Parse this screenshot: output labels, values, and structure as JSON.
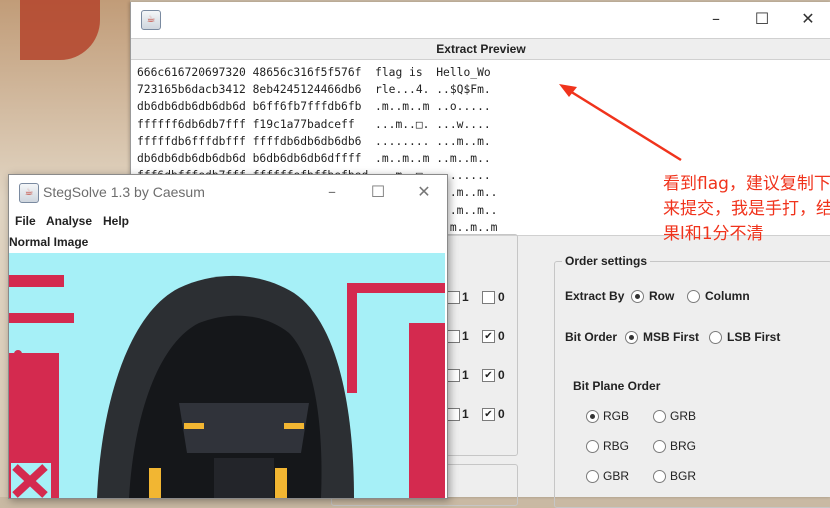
{
  "colors": {
    "annotation_red": "#f0331c",
    "image_cyan": "#a6f0f7",
    "image_magenta": "#d42a4f"
  },
  "extract_window": {
    "icon": "java-cup-icon",
    "panel_title": "Extract Preview",
    "text_lines": [
      "666c616720697320 48656c316f5f576f  flag is  Hello_Wo",
      "723165b6dacb3412 8eb4245124466db6  rle...4. ..$Q$Fm.",
      "db6db6db6db6db6d b6ff6fb7fffdb6fb  .m..m..m ..o.....",
      "ffffff6db6db7fff f19c1a77badceff   ...m..□. ...w....",
      "fffffdb6fffdbfff ffffdb6db6db6db6  ........ ...m..m.",
      "db6db6db6db6db6d b6db6db6db6dffff  .m..m..m ..m..m..",
      "fff6dbfffedb7fff ffffffefbffbefbed ...m..□. ........",
      "                                    .m..m..m ..m..m..",
      "                                    .m..m..m ..m..m..",
      "                                    .m..m..m .m..m..m"
    ],
    "order_settings": {
      "title": "Order settings",
      "extract_by_label": "Extract By",
      "extract_by_options": [
        "Row",
        "Column"
      ],
      "extract_by_selected": "Row",
      "bit_order_label": "Bit Order",
      "bit_order_options": [
        "MSB First",
        "LSB First"
      ],
      "bit_order_selected": "MSB First",
      "bit_plane_order_label": "Bit Plane Order",
      "bit_plane_options": [
        "RGB",
        "GRB",
        "RBG",
        "BRG",
        "GBR",
        "BGR"
      ],
      "bit_plane_selected": "RGB"
    },
    "bit_planes": [
      {
        "one": "1",
        "zero": "0",
        "zero_checked": false
      },
      {
        "one": "1",
        "zero": "0",
        "zero_checked": true
      },
      {
        "one": "1",
        "zero": "0",
        "zero_checked": true
      },
      {
        "one": "1",
        "zero": "0",
        "zero_checked": true
      }
    ],
    "annotation_text": "看到flag，建议复制下来提交，我是手打，结果l和1分不清"
  },
  "stegsolve_window": {
    "icon": "java-cup-icon",
    "title": "StegSolve 1.3 by Caesum",
    "menu": [
      "File",
      "Analyse",
      "Help"
    ],
    "image_label": "Normal Image"
  }
}
